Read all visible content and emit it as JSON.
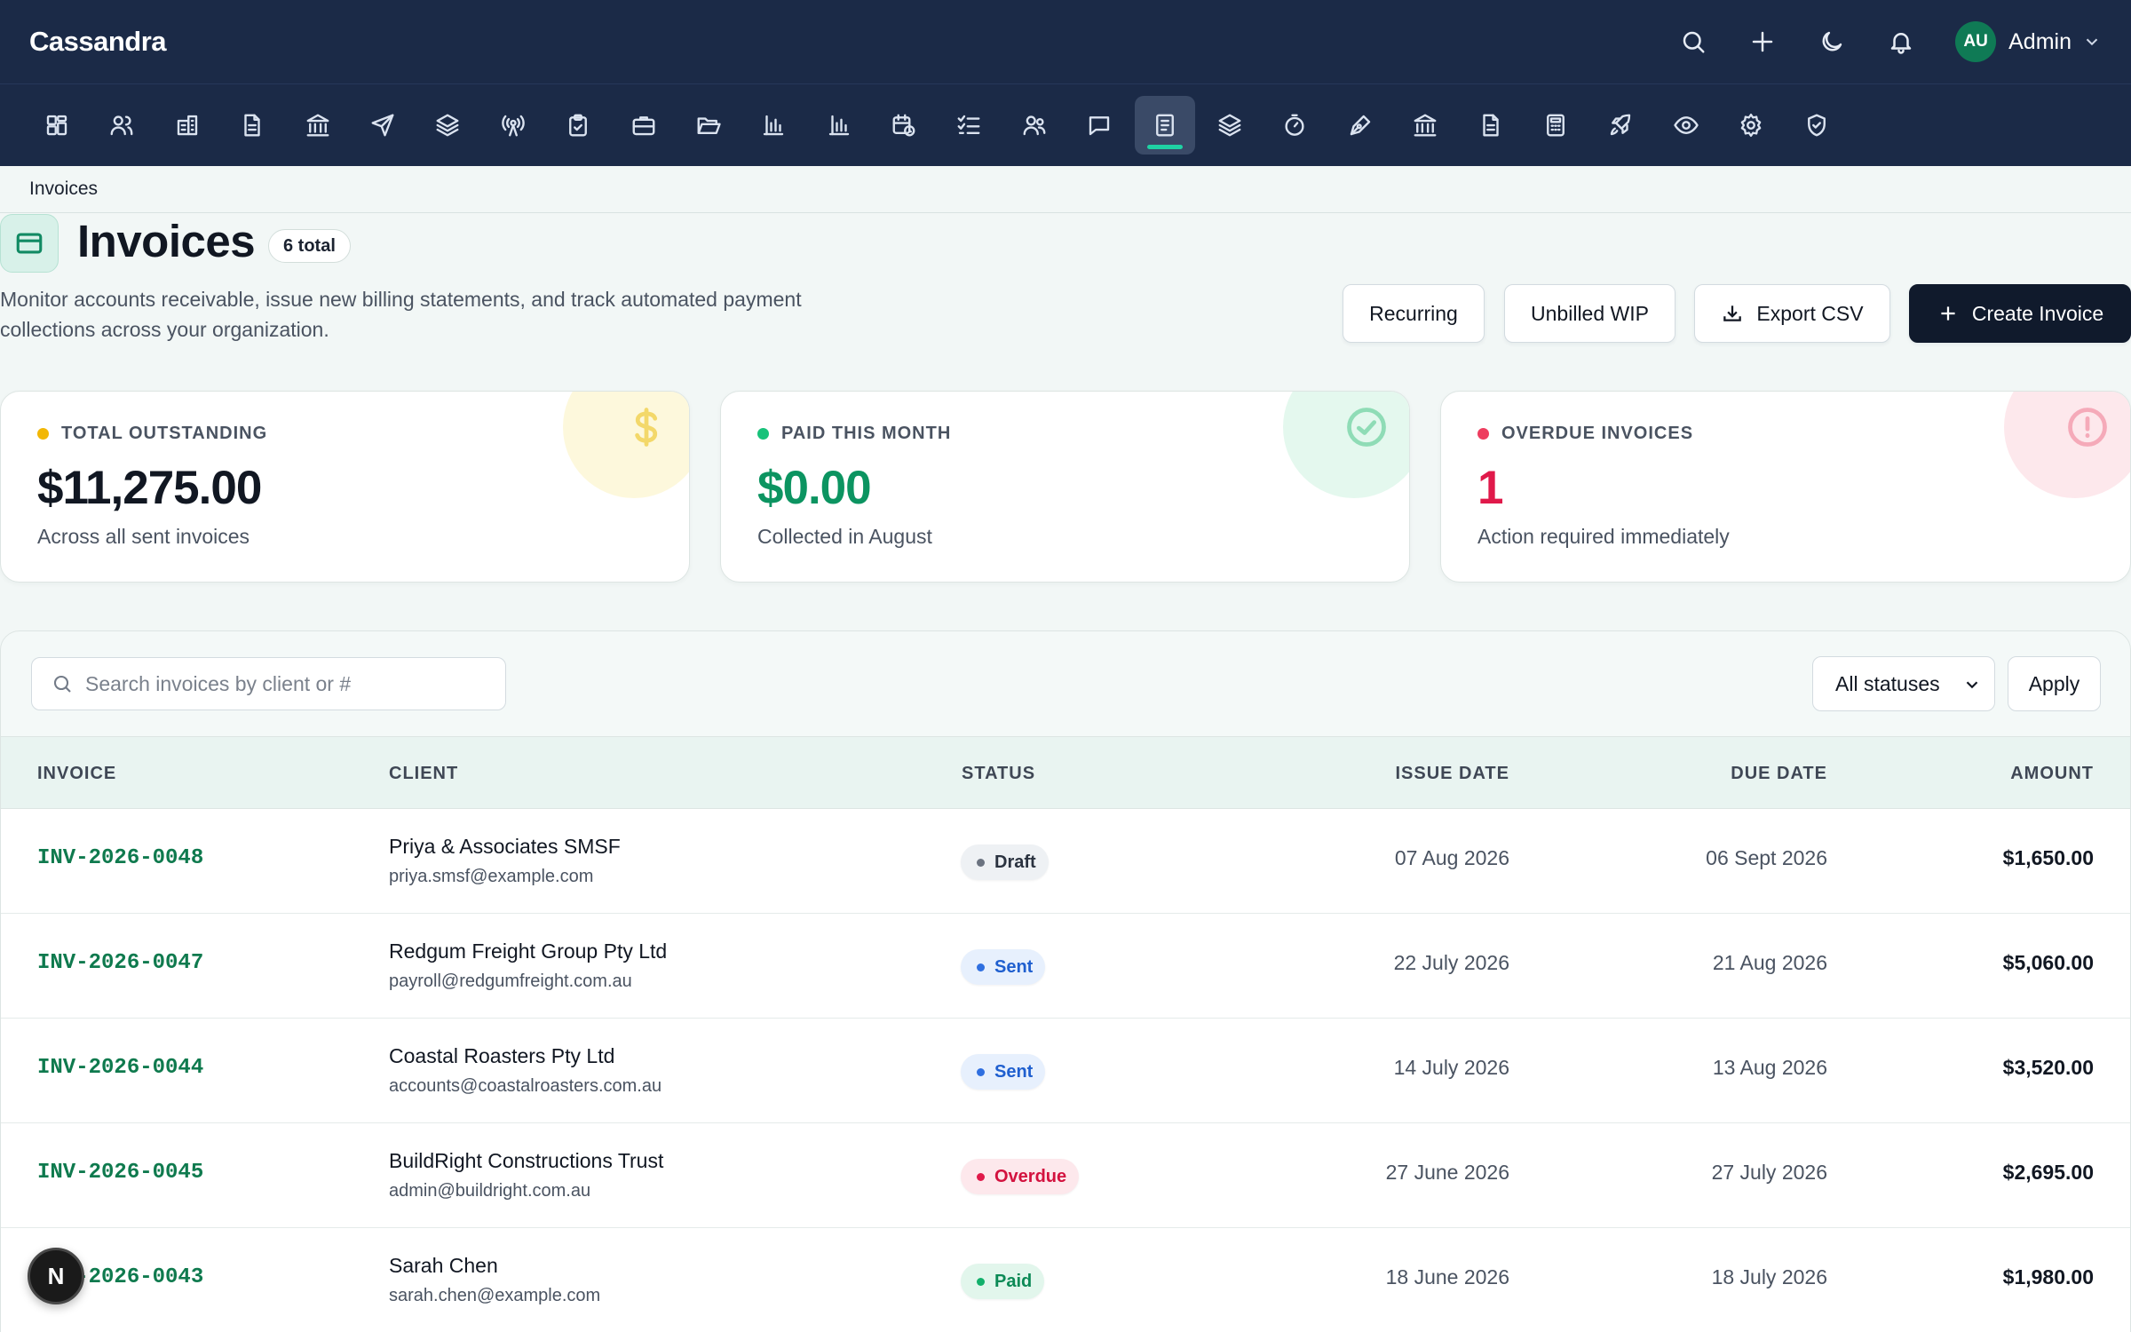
{
  "app": {
    "brand": "Cassandra"
  },
  "topbar": {
    "icons": [
      "search-icon",
      "plus-icon",
      "moon-icon",
      "bell-icon"
    ],
    "user": {
      "initials": "AU",
      "name": "Admin"
    }
  },
  "modules": [
    "dashboard-icon",
    "users-icon",
    "building-icon",
    "document-icon",
    "bank-icon",
    "send-icon",
    "layers-icon",
    "broadcast-icon",
    "clipboard-icon",
    "briefcase-icon",
    "folder-open-icon",
    "bar-chart-icon",
    "bar-chart-icon",
    "calendar-clock-icon",
    "checklist-icon",
    "people-icon",
    "message-icon",
    "invoice-icon",
    "layers-icon",
    "timer-icon",
    "pen-tool-icon",
    "bank-icon",
    "document-icon",
    "calculator-icon",
    "rocket-icon",
    "eye-icon",
    "settings-icon",
    "shield-check-icon"
  ],
  "active_module_index": 17,
  "breadcrumb": "Invoices",
  "header": {
    "title": "Invoices",
    "count_badge": "6 total",
    "subtitle": "Monitor accounts receivable, issue new billing statements, and track automated payment collections across your organization."
  },
  "actions": {
    "recurring": "Recurring",
    "unbilled_wip": "Unbilled WIP",
    "export_csv": "Export CSV",
    "create_invoice": "Create Invoice"
  },
  "stats": [
    {
      "label": "TOTAL OUTSTANDING",
      "value": "$11,275.00",
      "note": "Across all sent invoices",
      "dot_color": "#f2b705",
      "value_color": "#111722",
      "deco_bg": "#fdf8dc",
      "deco_stroke": "#f3d86a",
      "icon": "dollar-icon"
    },
    {
      "label": "PAID THIS MONTH",
      "value": "$0.00",
      "note": "Collected in August",
      "dot_color": "#18c27a",
      "value_color": "#0c9461",
      "deco_bg": "#e4f8ee",
      "deco_stroke": "#8fdcb6",
      "icon": "check-circle-icon"
    },
    {
      "label": "OVERDUE INVOICES",
      "value": "1",
      "note": "Action required immediately",
      "dot_color": "#ee3d5f",
      "value_color": "#e0194a",
      "deco_bg": "#fde8ec",
      "deco_stroke": "#f5aab9",
      "icon": "alert-circle-icon"
    }
  ],
  "filters": {
    "search_placeholder": "Search invoices by client or #",
    "search_value": "",
    "status_selected": "All statuses",
    "apply": "Apply"
  },
  "table": {
    "headers": {
      "invoice": "INVOICE",
      "client": "CLIENT",
      "status": "STATUS",
      "issue_date": "ISSUE DATE",
      "due_date": "DUE DATE",
      "amount": "AMOUNT"
    },
    "rows": [
      {
        "invoice": "INV-2026-0048",
        "client": "Priya & Associates SMSF",
        "email": "priya.smsf@example.com",
        "status": "Draft",
        "issue_date": "07 Aug 2026",
        "due_date": "06 Sept 2026",
        "amount": "$1,650.00"
      },
      {
        "invoice": "INV-2026-0047",
        "client": "Redgum Freight Group Pty Ltd",
        "email": "payroll@redgumfreight.com.au",
        "status": "Sent",
        "issue_date": "22 July 2026",
        "due_date": "21 Aug 2026",
        "amount": "$5,060.00"
      },
      {
        "invoice": "INV-2026-0044",
        "client": "Coastal Roasters Pty Ltd",
        "email": "accounts@coastalroasters.com.au",
        "status": "Sent",
        "issue_date": "14 July 2026",
        "due_date": "13 Aug 2026",
        "amount": "$3,520.00"
      },
      {
        "invoice": "INV-2026-0045",
        "client": "BuildRight Constructions Trust",
        "email": "admin@buildright.com.au",
        "status": "Overdue",
        "issue_date": "27 June 2026",
        "due_date": "27 July 2026",
        "amount": "$2,695.00"
      },
      {
        "invoice": "INV-2026-0043",
        "client": "Sarah Chen",
        "email": "sarah.chen@example.com",
        "status": "Paid",
        "issue_date": "18 June 2026",
        "due_date": "18 July 2026",
        "amount": "$1,980.00"
      }
    ]
  },
  "status_styles": {
    "Draft": {
      "bg": "#eef1f4",
      "fg": "#2b3340",
      "dot": "#6b7380"
    },
    "Sent": {
      "bg": "#e7f0fd",
      "fg": "#1f5fcf",
      "dot": "#2f6fe0"
    },
    "Overdue": {
      "bg": "#fde8ec",
      "fg": "#d3123f",
      "dot": "#e0194a"
    },
    "Paid": {
      "bg": "#e2f6ec",
      "fg": "#0c8a56",
      "dot": "#12b06b"
    }
  },
  "fab": {
    "label": "N"
  }
}
